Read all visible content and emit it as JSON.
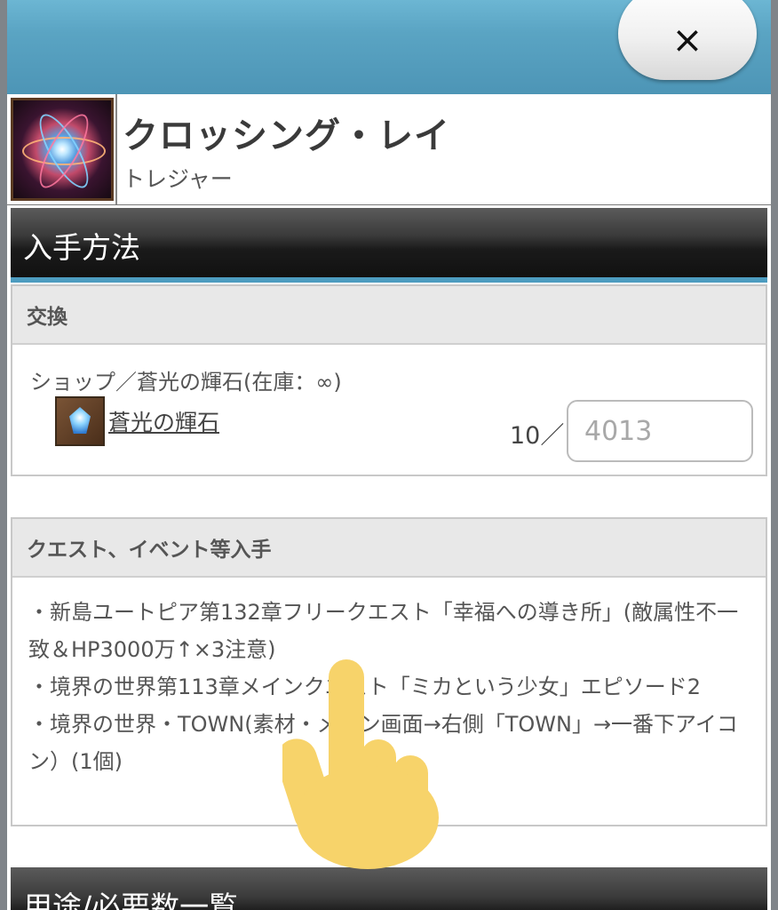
{
  "header": {
    "close_label": "×"
  },
  "item": {
    "name": "クロッシング・レイ",
    "type": "トレジャー",
    "icon": "crossing-ray-atom-icon"
  },
  "acquisition": {
    "title": "入手方法",
    "exchange": {
      "header": "交換",
      "shop_line": "ショップ／蒼光の輝石(在庫：∞)",
      "currency_link": "蒼光の輝石",
      "currency_icon": "blue-gem-icon",
      "count_label": "10／",
      "quantity_placeholder": "4013"
    },
    "quests": {
      "header": "クエスト、イベント等入手",
      "lines": [
        "・新島ユートピア第132章フリークエスト「幸福への導き所」(敵属性不一致＆HP3000万↑×3注意)",
        "・境界の世界第113章メインクエスト「ミカという少女」エピソード2",
        "・境界の世界・TOWN(素材・メイン画面→右側「TOWN」→一番下アイコン）(1個)"
      ]
    }
  },
  "usage": {
    "title": "用途/必要数一覧"
  },
  "overlay": {
    "icon": "pointing-hand-icon"
  },
  "colors": {
    "topbar": "#5aa4c3",
    "section_bar": "#1a1a1a",
    "accent_line": "#4d9cc0",
    "hand": "#f7d36a"
  }
}
